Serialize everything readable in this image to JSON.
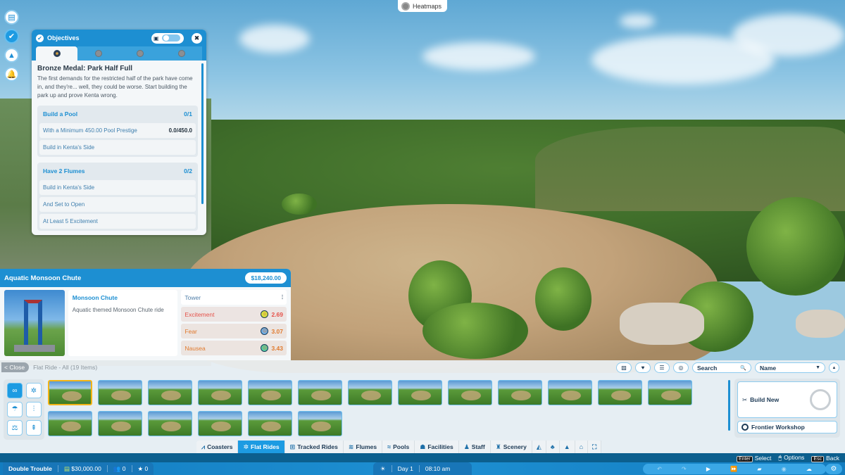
{
  "heatmaps": {
    "label": "Heatmaps"
  },
  "rail": {
    "items": [
      {
        "name": "clipboard",
        "icon": "clipboard-icon",
        "glyph": "▤"
      },
      {
        "name": "objectives",
        "icon": "check-icon",
        "glyph": "✔",
        "active": true
      },
      {
        "name": "terrain",
        "icon": "terrain-add-icon",
        "glyph": "▲"
      },
      {
        "name": "notifications",
        "icon": "bell-icon",
        "glyph": "🔔"
      }
    ]
  },
  "objectives": {
    "title": "Objectives",
    "check_glyph": "✔",
    "close_glyph": "✖",
    "toggle_icon_glyph": "▣",
    "tabs": [
      {
        "medal": "bronze",
        "active": true
      },
      {
        "medal": "silver"
      },
      {
        "medal": "gold"
      },
      {
        "medal": "platinum"
      }
    ],
    "heading": "Bronze Medal: Park Half Full",
    "description": "The first demands for the restricted half of the park have come in, and they're... well, they could be worse. Start building the park up and prove Kenta wrong.",
    "goals": [
      {
        "title": "Build a Pool",
        "progress": "0/1",
        "rows": [
          {
            "label": "With a Minimum 450.00 Pool Prestige",
            "value": "0.0/450.0"
          },
          {
            "label": "Build in Kenta's Side",
            "value": ""
          }
        ]
      },
      {
        "title": "Have 2 Flumes",
        "progress": "0/2",
        "rows": [
          {
            "label": "Build in Kenta's Side",
            "value": ""
          },
          {
            "label": "And Set to Open",
            "value": ""
          },
          {
            "label": "At Least 5 Excitement",
            "value": ""
          }
        ]
      }
    ]
  },
  "ride": {
    "title": "Aquatic Monsoon Chute",
    "price": "$18,240.00",
    "name": "Monsoon Chute",
    "description": "Aquatic themed Monsoon Chute ride",
    "type_label": "Tower",
    "type_glyph": "⫶",
    "stats": [
      {
        "label": "Excitement",
        "value": "2.69",
        "face": "happy",
        "glyph": "☺"
      },
      {
        "label": "Fear",
        "value": "3.07",
        "face": "scared",
        "glyph": "☹"
      },
      {
        "label": "Nausea",
        "value": "3.43",
        "face": "sick",
        "glyph": "☹"
      }
    ]
  },
  "browser": {
    "close_label": "< Close",
    "title": "Flat Ride - All (19 Items)",
    "tools": [
      {
        "name": "blueprint-toggle",
        "glyph": "▨"
      },
      {
        "name": "favourites",
        "glyph": "♥"
      },
      {
        "name": "filters",
        "glyph": "☰"
      },
      {
        "name": "view",
        "glyph": "◎"
      }
    ],
    "search_placeholder": "Search",
    "search_glyph": "🔍",
    "sort_value": "Name",
    "sort_glyph": "▼",
    "collapse_glyph": "▲",
    "filters": [
      {
        "name": "all",
        "glyph": "∞",
        "active": true
      },
      {
        "name": "spinning",
        "glyph": "✲"
      },
      {
        "name": "swing",
        "glyph": "☂"
      },
      {
        "name": "tower",
        "glyph": "⫶"
      },
      {
        "name": "balance",
        "glyph": "⚖"
      },
      {
        "name": "drop",
        "glyph": "⇞"
      }
    ],
    "item_count": 19,
    "selected_index": 0,
    "build_new_label": "Build New",
    "build_new_glyph": "✂",
    "workshop_label": "Frontier Workshop"
  },
  "categories": [
    {
      "label": "Coasters",
      "glyph": "⩘",
      "active": false
    },
    {
      "label": "Flat Rides",
      "glyph": "✲",
      "active": true
    },
    {
      "label": "Tracked Rides",
      "glyph": "⊞",
      "active": false
    },
    {
      "label": "Flumes",
      "glyph": "≋",
      "active": false
    },
    {
      "label": "Pools",
      "glyph": "≈",
      "active": false
    },
    {
      "label": "Facilities",
      "glyph": "☗",
      "active": false
    },
    {
      "label": "Staff",
      "glyph": "♟",
      "active": false
    },
    {
      "label": "Scenery",
      "glyph": "♜",
      "active": false
    }
  ],
  "category_icons": [
    {
      "name": "terrain",
      "glyph": "◭"
    },
    {
      "name": "trees",
      "glyph": "♣"
    },
    {
      "name": "mountain",
      "glyph": "▲"
    },
    {
      "name": "blueprints",
      "glyph": "⌂"
    },
    {
      "name": "expand",
      "glyph": "⛶"
    }
  ],
  "hints": [
    {
      "key": "Enter",
      "label": "Select"
    },
    {
      "key": "🖱",
      "label": "Options"
    },
    {
      "key": "Esc",
      "label": "Back"
    }
  ],
  "status": {
    "park_name": "Double Trouble",
    "money": "$30,000.00",
    "guests": "0",
    "rating": "0",
    "weather_glyph": "☀",
    "day": "Day 1",
    "time": "08:10 am"
  },
  "controls": [
    {
      "name": "undo",
      "glyph": "↶",
      "dim": true
    },
    {
      "name": "redo",
      "glyph": "↷",
      "dim": true
    },
    {
      "name": "play",
      "glyph": "▶"
    },
    {
      "name": "fast-forward",
      "glyph": "⏩"
    },
    {
      "name": "camera",
      "glyph": "▰"
    },
    {
      "name": "globe",
      "glyph": "◉",
      "dim": true
    },
    {
      "name": "weather",
      "glyph": "☁"
    }
  ],
  "settings_glyph": "⚙"
}
